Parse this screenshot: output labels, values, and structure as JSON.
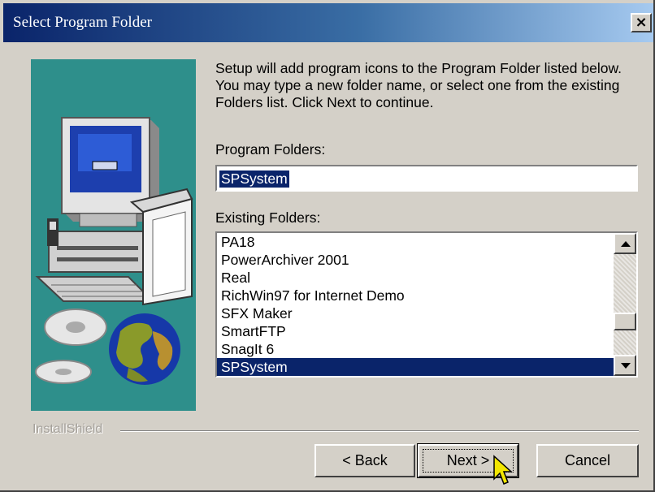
{
  "window": {
    "title": "Select Program Folder",
    "close_label": "×"
  },
  "intro_text": "Setup will add program icons to the Program Folder listed below. You may type a new folder name, or select one from the existing Folders list.  Click Next to continue.",
  "program_folders": {
    "label": "Program Folders:",
    "value": "SPSystem"
  },
  "existing_folders": {
    "label": "Existing Folders:",
    "items": [
      "PA18",
      "PowerArchiver 2001",
      "Real",
      "RichWin97 for Internet Demo",
      "SFX Maker",
      "SmartFTP",
      "SnagIt 6",
      "SPSystem"
    ],
    "selected": "SPSystem"
  },
  "brand": "InstallShield",
  "buttons": {
    "back": "< Back",
    "next": "Next >",
    "cancel": "Cancel"
  },
  "colors": {
    "title_bar": "#0a246a",
    "side_panel": "#2e8f8b",
    "selection": "#0a246a",
    "dialog_face": "#d4d0c8"
  }
}
